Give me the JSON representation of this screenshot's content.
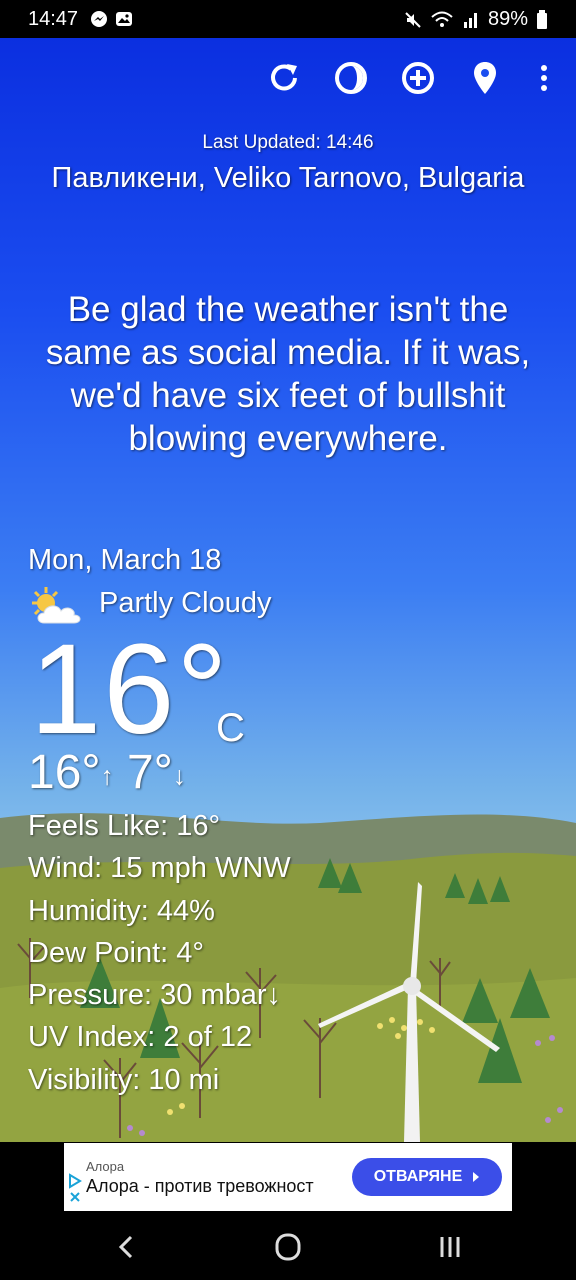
{
  "status_bar": {
    "time": "14:47",
    "battery": "89%",
    "icons": [
      "messenger-icon",
      "gallery-icon",
      "mute-icon",
      "wifi-icon",
      "signal-icon",
      "battery-icon"
    ]
  },
  "toolbar": {
    "icons": [
      "refresh-icon",
      "theme-icon",
      "add-location-icon",
      "location-pin-icon",
      "more-options-icon"
    ]
  },
  "header": {
    "last_updated": "Last Updated: 14:46",
    "location": "Павликени, Veliko Tarnovo, Bulgaria"
  },
  "quote": "Be glad the weather isn't the same as social media. If it was, we'd have six feet of bullshit blowing everywhere.",
  "current": {
    "date": "Mon, March 18",
    "condition": "Partly Cloudy",
    "condition_icon": "partly-cloudy-icon",
    "temperature": "16°",
    "unit": "C",
    "high": "16°",
    "high_arrow": "↑",
    "low": "7°",
    "low_arrow": "↓"
  },
  "details": [
    "Feels Like:  16°",
    "Wind:  15 mph WNW",
    "Humidity:  44%",
    "Dew Point:  4°",
    "Pressure:  30 mbar↓",
    "UV Index:  2 of 12",
    "Visibility:  10 mi"
  ],
  "ad": {
    "brand": "Алора",
    "text": "Алора - против тревожност",
    "cta": "ОТВАРЯНЕ"
  },
  "navigation": {
    "icons": [
      "back-icon",
      "home-icon",
      "recents-icon"
    ]
  },
  "colors": {
    "sky_top": "#0b2fe0",
    "sky_bottom": "#8fc4ee",
    "grass": "#8a9a3e",
    "ad_button": "#3b4ee8"
  }
}
